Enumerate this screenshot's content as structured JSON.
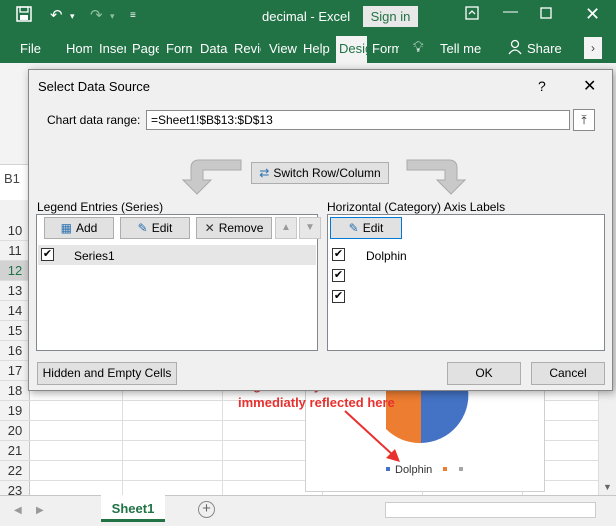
{
  "window": {
    "title": "decimal - Excel",
    "signin_label": "Sign in"
  },
  "ribbon": {
    "tabs": [
      "File",
      "Hom",
      "Inser",
      "Page",
      "Form",
      "Data",
      "Revie",
      "View",
      "Help",
      "Desig",
      "Form"
    ],
    "active_tab": "Desig",
    "tellme": "Tell me",
    "share": "Share"
  },
  "sheet": {
    "namebox": "B1",
    "row_numbers": [
      "10",
      "11",
      "12",
      "13",
      "14",
      "15",
      "16",
      "17",
      "18",
      "19",
      "20",
      "21",
      "22",
      "23"
    ],
    "selected_row": "12",
    "active_sheet_tab": "Sheet1"
  },
  "dialog": {
    "title": "Select Data Source",
    "help": "?",
    "chart_range_label": "Chart data range:",
    "chart_range_value": "=Sheet1!$B$13:$D$13",
    "switch_label": "Switch Row/Column",
    "legend_header": "Legend Entries (Series)",
    "legend_buttons": {
      "add": "Add",
      "edit": "Edit",
      "remove": "Remove"
    },
    "series": [
      {
        "label": "Series1",
        "checked": true
      }
    ],
    "axis_header": "Horizontal (Category) Axis Labels",
    "axis_edit": "Edit",
    "categories": [
      {
        "label": "Dolphin",
        "checked": true
      },
      {
        "label": "",
        "checked": true
      },
      {
        "label": "",
        "checked": true
      }
    ],
    "hidden_cells_label": "Hidden and Empty Cells",
    "ok_label": "OK",
    "cancel_label": "Cancel"
  },
  "chart": {
    "legend_label": "Dolphin",
    "slice_colors": [
      "#4472c4",
      "#ed7d31",
      "#a5a5a5"
    ]
  },
  "annotation": {
    "line1": "Legend Entry Name",
    "line2": "immediatly reflected here",
    "color": "#e8312f"
  }
}
